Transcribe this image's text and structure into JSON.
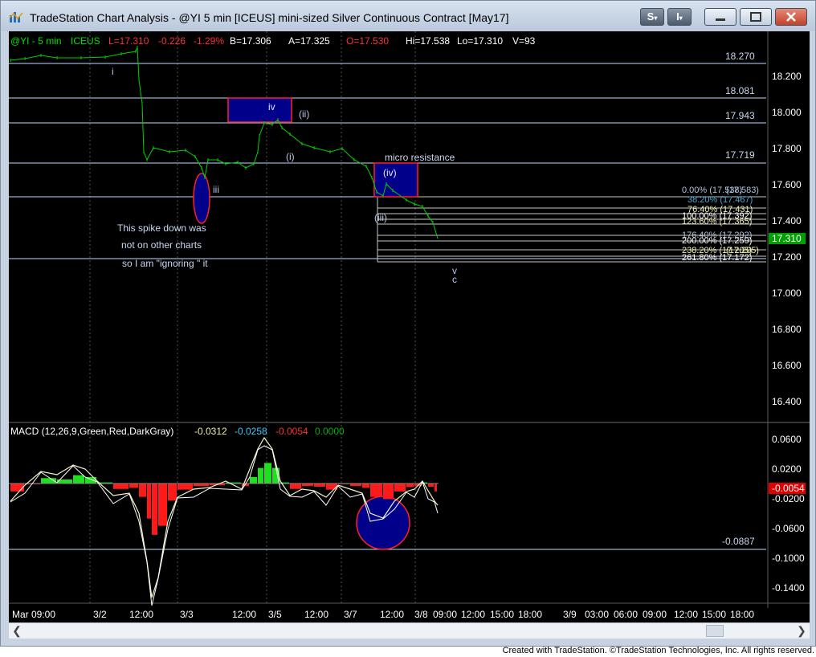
{
  "window": {
    "title": "TradeStation Chart Analysis - @YI 5 min [ICEUS] mini-sized Silver Continuous Contract [May17]",
    "buttons": {
      "s_label": "S",
      "i_label": "I"
    }
  },
  "price_header": {
    "symbol": "@YI - 5 min",
    "exchange": "ICEUS",
    "last": "L=17.310",
    "net_change": "-0.226",
    "pct_change": "-1.29%",
    "bid": "B=17.306",
    "ask": "A=17.325",
    "open": "O=17.530",
    "high": "Hi=17.538",
    "low": "Lo=17.310",
    "volume": "V=93"
  },
  "price_axis": {
    "ticks": [
      "18.200",
      "18.000",
      "17.800",
      "17.600",
      "17.400",
      "17.200",
      "17.000",
      "16.800",
      "16.600",
      "16.400"
    ],
    "last_price_label": "17.310"
  },
  "level_labels": [
    "18.270",
    "18.081",
    "17.943",
    "17.719"
  ],
  "fib_labels": [
    "0.00% (17.538)",
    "38.20% (17.467)",
    "76.40% (17.431)",
    "100.00% (17.392)",
    "123.60% (17.365)",
    "176.40% (17.292)",
    "200.00% (17.259)",
    "238.20% (17.205)",
    "261.80% (17.172)"
  ],
  "fib_overlap": {
    "a": "(17.583)",
    "b": "(17.205)"
  },
  "wave_labels": {
    "i": "i",
    "iii": "iii",
    "iv": "iv",
    "ii_paren": "(ii)",
    "i_paren": "(i)",
    "iv_paren": "(iv)",
    "iii_paren": "(iii)",
    "v": "v",
    "c": "c"
  },
  "annotations": {
    "micro_resistance": "micro resistance",
    "spike_line1": "This spike  down was",
    "spike_line2": "not on  other charts",
    "spike_line3": "so I am \"ignoring \" it"
  },
  "macd": {
    "label": "MACD (12,26,9,Green,Red,DarkGray)",
    "value1": "-0.0312",
    "value2": "-0.0258",
    "value3": "-0.0054",
    "value4": "0.0000",
    "axis_ticks": [
      "0.0600",
      "0.0200",
      "-0.0200",
      "-0.0600",
      "-0.1000",
      "-0.1400"
    ],
    "current_label": "-0.0054",
    "level_label": "-0.0887"
  },
  "time_axis": {
    "labels": [
      "Mar 09:00",
      "3/2",
      "12:00",
      "3/3",
      "12:00",
      "3/5",
      "12:00",
      "3/7",
      "12:00",
      "3/8",
      "09:00",
      "12:00",
      "15:00",
      "18:00",
      "3/9",
      "03:00",
      "06:00",
      "09:00",
      "12:00",
      "15:00",
      "18:00"
    ]
  },
  "footer": "Created with TradeStation. ©TradeStation Technologies, Inc. All rights reserved.",
  "colors": {
    "price_bars": "#00d000",
    "macd_green": "#1fe01f",
    "macd_red": "#ff1a1a",
    "macd_line": "#f5f5c8",
    "signal_line": "#ffffff",
    "box_fill": "#00008b",
    "box_border": "#ff0000",
    "level_line": "#c0d8ff",
    "last_price_bg": "#00a000",
    "macd_current_bg": "#e00000"
  }
}
